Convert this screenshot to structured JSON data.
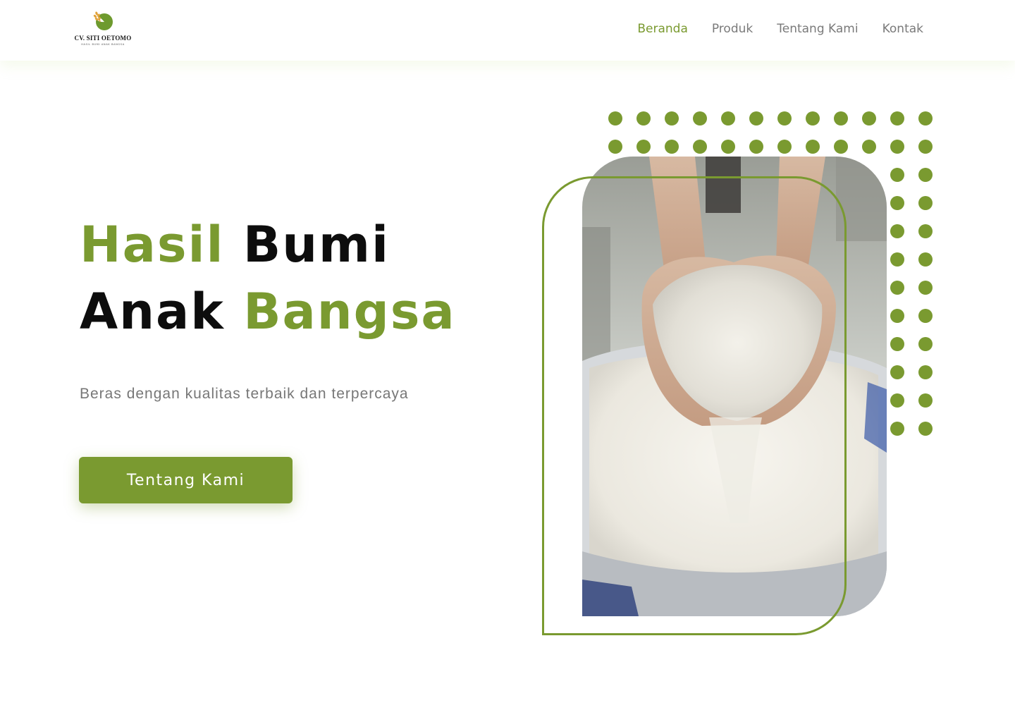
{
  "header": {
    "logo": {
      "name": "CV. SITI OETOMO",
      "tagline": "HASIL BUMI ANAK BANGSA"
    },
    "nav": [
      {
        "label": "Beranda",
        "active": true
      },
      {
        "label": "Produk",
        "active": false
      },
      {
        "label": "Tentang Kami",
        "active": false
      },
      {
        "label": "Kontak",
        "active": false
      }
    ]
  },
  "hero": {
    "title_line1_word1": "Hasil",
    "title_line1_word2": "Bumi",
    "title_line2_word1": "Anak",
    "title_line2_word2": "Bangsa",
    "subtitle": "Beras dengan kualitas terbaik dan terpercaya",
    "cta_label": "Tentang Kami"
  },
  "visual": {
    "image_subject": "hands-holding-rice-photo",
    "pattern": "dot-grid"
  },
  "colors": {
    "accent": "#7a9a30",
    "text_dark": "#0d0d0d",
    "text_muted": "#777777"
  }
}
